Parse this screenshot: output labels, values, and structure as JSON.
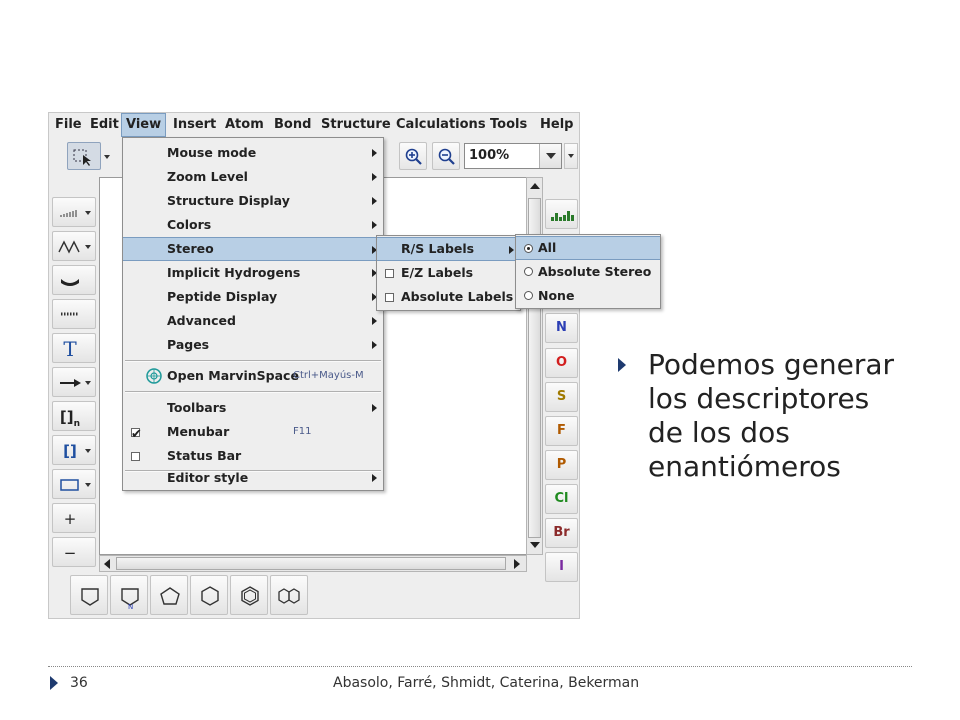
{
  "menubar": {
    "items": [
      "File",
      "Edit",
      "View",
      "Insert",
      "Atom",
      "Bond",
      "Structure",
      "Calculations",
      "Tools",
      "Help"
    ],
    "open_menu": "View"
  },
  "toolbar": {
    "zoom_value": "100%"
  },
  "left_tools": {
    "items": [
      "chain-bond",
      "zigzag-chain",
      "wedge-bond",
      "hashed-bond",
      "text",
      "arrow",
      "bracket-n",
      "bracket",
      "rectangle",
      "plus",
      "minus"
    ],
    "text_label": "T",
    "bracket_label": "[]",
    "bracket_n_sub": "n",
    "plus_label": "+",
    "minus_label": "−"
  },
  "atoms": {
    "items": [
      {
        "symbol": "N",
        "color": "#2c3fb5"
      },
      {
        "symbol": "O",
        "color": "#d21e1e"
      },
      {
        "symbol": "S",
        "color": "#a07a00"
      },
      {
        "symbol": "F",
        "color": "#b05a00"
      },
      {
        "symbol": "P",
        "color": "#b05a00"
      },
      {
        "symbol": "Cl",
        "color": "#1f8a1f"
      },
      {
        "symbol": "Br",
        "color": "#8b2a2a"
      },
      {
        "symbol": "I",
        "color": "#7a2aa0"
      }
    ]
  },
  "view_menu": {
    "items": [
      {
        "label": "Mouse mode",
        "submenu": true
      },
      {
        "label": "Zoom Level",
        "submenu": true
      },
      {
        "label": "Structure Display",
        "submenu": true
      },
      {
        "label": "Colors",
        "submenu": true
      },
      {
        "label": "Stereo",
        "submenu": true,
        "highlighted": true
      },
      {
        "label": "Implicit Hydrogens",
        "submenu": true
      },
      {
        "label": "Peptide Display",
        "submenu": true
      },
      {
        "label": "Advanced",
        "submenu": true
      },
      {
        "label": "Pages",
        "submenu": true
      },
      {
        "label": "Open MarvinSpace",
        "accelerator": "Ctrl+Mayús-M",
        "icon": "marvinspace-icon"
      },
      {
        "label": "Toolbars",
        "submenu": true
      },
      {
        "label": "Menubar",
        "accelerator": "F11",
        "checked": true
      },
      {
        "label": "Status Bar",
        "checked": false
      },
      {
        "label": "Editor style",
        "submenu": true
      }
    ]
  },
  "stereo_menu": {
    "items": [
      {
        "label": "R/S Labels",
        "submenu": true,
        "highlighted": true
      },
      {
        "label": "E/Z Labels",
        "checked": false
      },
      {
        "label": "Absolute Labels",
        "checked": false
      }
    ]
  },
  "rs_menu": {
    "items": [
      {
        "label": "All",
        "selected": true
      },
      {
        "label": "Absolute Stereo",
        "selected": false
      },
      {
        "label": "None",
        "selected": false
      }
    ]
  },
  "slide": {
    "bullet_lines": [
      "Podemos generar",
      "los descriptores",
      "de los dos",
      "enantiómeros"
    ],
    "page_number": "36",
    "authors": "Abasolo, Farré, Shmidt, Caterina, Bekerman"
  }
}
